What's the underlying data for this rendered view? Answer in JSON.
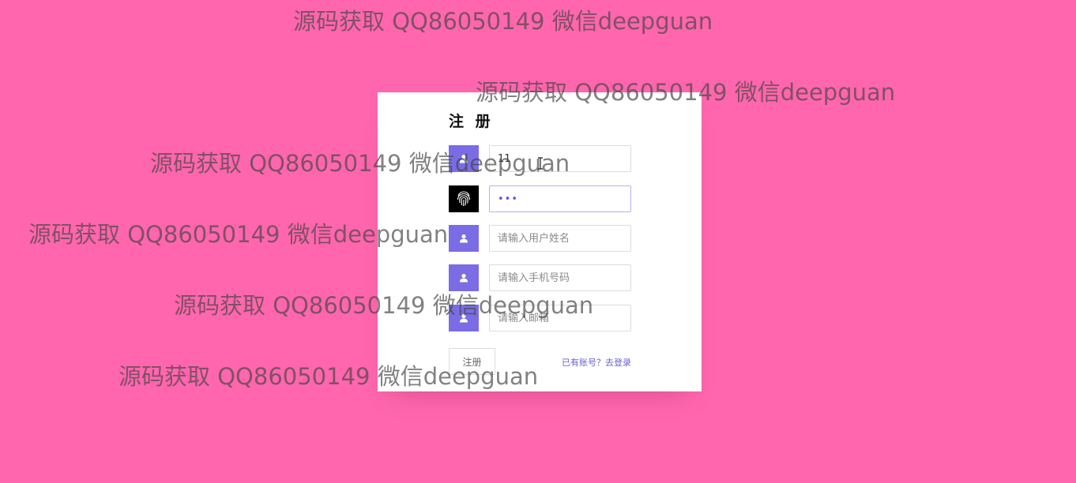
{
  "form": {
    "title": "注 册",
    "fields": [
      {
        "icon": "user-icon",
        "value": "11",
        "placeholder": ""
      },
      {
        "icon": "fingerprint-icon",
        "value": "•••",
        "placeholder": ""
      },
      {
        "icon": "user-icon",
        "value": "",
        "placeholder": "请输入用户姓名"
      },
      {
        "icon": "user-icon",
        "value": "",
        "placeholder": "请输入手机号码"
      },
      {
        "icon": "user-icon",
        "value": "",
        "placeholder": "请输入邮箱"
      }
    ],
    "register_label": "注册",
    "login_link": "已有账号？去登录"
  },
  "watermark": {
    "text": "源码获取 QQ86050149 微信deepguan"
  },
  "colors": {
    "background": "#ff66ad",
    "accent": "#7b6ce6",
    "card": "#ffffff"
  }
}
